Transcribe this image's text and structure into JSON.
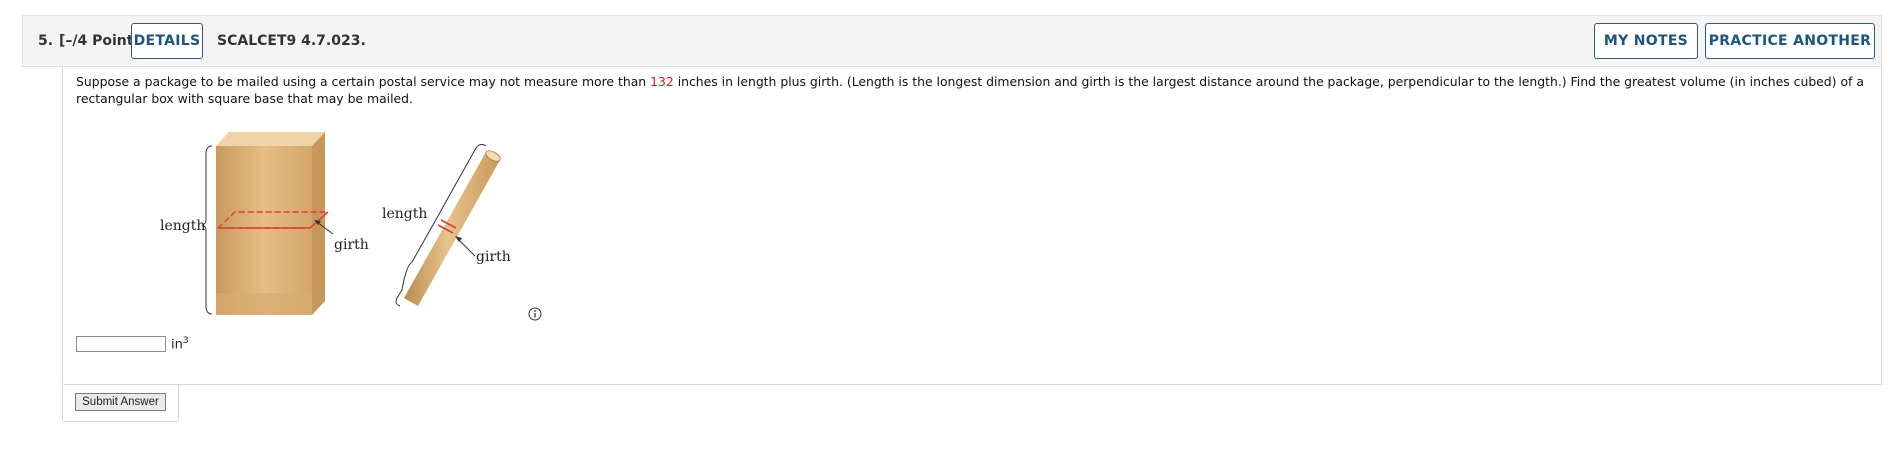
{
  "header": {
    "number": "5.",
    "points": "[–/4 Points]",
    "details_label": "DETAILS",
    "code": "SCALCET9 4.7.023.",
    "my_notes_label": "MY NOTES",
    "practice_label": "PRACTICE ANOTHER"
  },
  "question": {
    "text_before": "Suppose a package to be mailed using a certain postal service may not measure more than ",
    "highlight_value": "132",
    "text_after": " inches in length plus girth. (Length is the longest dimension and girth is the largest distance around the package, perpendicular to the length.) Find the greatest volume (in inches cubed) of a rectangular box with square base that may be mailed."
  },
  "figure": {
    "box_length_label": "length",
    "box_girth_label": "girth",
    "tube_length_label": "length",
    "tube_girth_label": "girth",
    "box_color": "#d9ab6f",
    "girth_color": "#e23b3b"
  },
  "answer": {
    "value": "",
    "unit": "in",
    "unit_exp": "3"
  },
  "submit_label": "Submit Answer",
  "icons": {
    "info": "info-circle-icon"
  }
}
